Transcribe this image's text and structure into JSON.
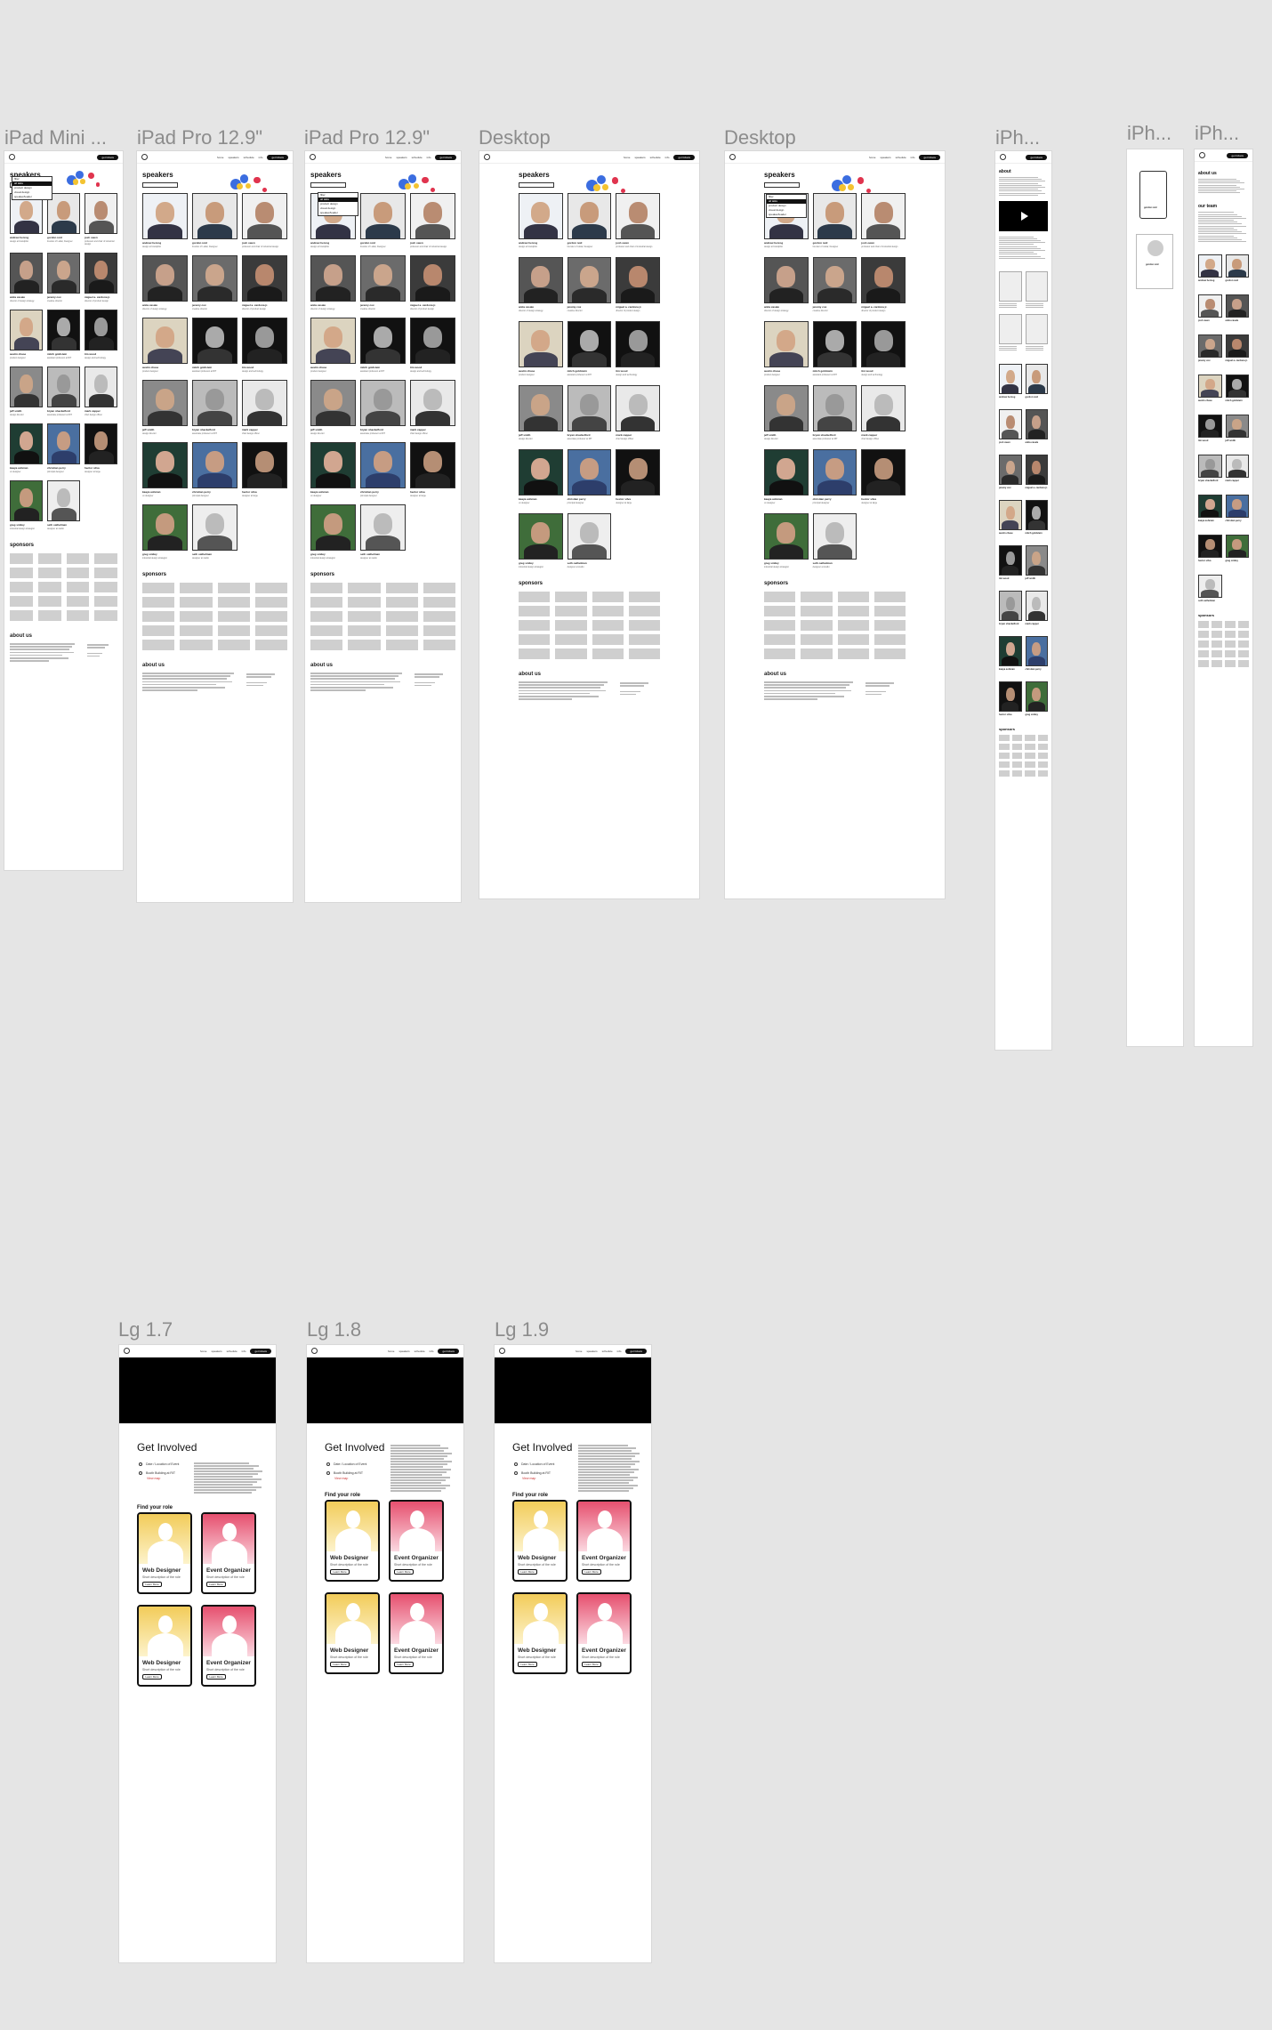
{
  "frames": {
    "ipad_mini": "iPad Mini ...",
    "ipad_pro_1": "iPad Pro 12.9\"",
    "ipad_pro_2": "iPad Pro 12.9\"",
    "desktop_1": "Desktop",
    "desktop_2": "Desktop",
    "iphone_1": "iPh...",
    "iphone_2": "iPh...",
    "iphone_3": "iPh...",
    "lg17": "Lg 1.7",
    "lg18": "Lg 1.8",
    "lg19": "Lg 1.9"
  },
  "nav": {
    "links": [
      "home",
      "speakers",
      "schedule",
      "info"
    ],
    "cta": "get tickets"
  },
  "speakers_title": "speakers",
  "filter_options": [
    "filter",
    "all talks",
    "product design",
    "visual design",
    "speaker/leader"
  ],
  "speakers": [
    {
      "name": "andrew herzog",
      "role": "design at brandpilot"
    },
    {
      "name": "gordon reid",
      "role": "founder of l-sklar, Designer"
    },
    {
      "name": "josh owen",
      "role": "professor and chair of industrial design"
    },
    {
      "name": "anita casale",
      "role": "director of design strategy"
    },
    {
      "name": "jeremy cox",
      "role": "creative director"
    },
    {
      "name": "miguel a. cardona jr.",
      "role": "director of product design"
    },
    {
      "name": "austin chase",
      "role": "product designer"
    },
    {
      "name": "mitch goldstein",
      "role": "assistant professor at RIT"
    },
    {
      "name": "tim wood",
      "role": "design and technology"
    },
    {
      "name": "jeff smith",
      "role": "design director"
    },
    {
      "name": "bryan shackelford",
      "role": "associate professor at RIT"
    },
    {
      "name": "mark capper",
      "role": "chief design officer"
    },
    {
      "name": "kaaya ashman",
      "role": "ux designer"
    },
    {
      "name": "christian perry",
      "role": "principal designer"
    },
    {
      "name": "hector silva",
      "role": "designer at large"
    },
    {
      "name": "greg smiley",
      "role": "industrial design strategist"
    },
    {
      "name": "seth oathelman",
      "role": "designer at studio"
    }
  ],
  "sponsors_title": "sponsors",
  "about_title": "about us",
  "iphone": {
    "about_title": "about",
    "team_title": "our team",
    "card_name": "gordon reid"
  },
  "get_involved": {
    "title": "Get Involved",
    "date": "Date / Location of Event",
    "location": "Booth Building at RIT",
    "link": "View map",
    "find_role": "Find your role",
    "roles": [
      {
        "name": "Web Designer",
        "desc": "Short description of the role",
        "btn": "Learn More",
        "color": "yellow"
      },
      {
        "name": "Event Organizer",
        "desc": "Short description of the role",
        "btn": "Learn More",
        "color": "pink"
      },
      {
        "name": "Web Designer",
        "desc": "Short description of the role",
        "btn": "Learn More",
        "color": "yellow"
      },
      {
        "name": "Event Organizer",
        "desc": "Short description of the role",
        "btn": "Learn More",
        "color": "pink"
      }
    ]
  },
  "colors": {
    "canvas_bg": "#e5e5e5",
    "bubble_blue": "#3b6de0",
    "bubble_yellow": "#f3c331",
    "bubble_red": "#e0344e",
    "hero_black": "#000000",
    "sponsor_gray": "#cfcfcf"
  }
}
